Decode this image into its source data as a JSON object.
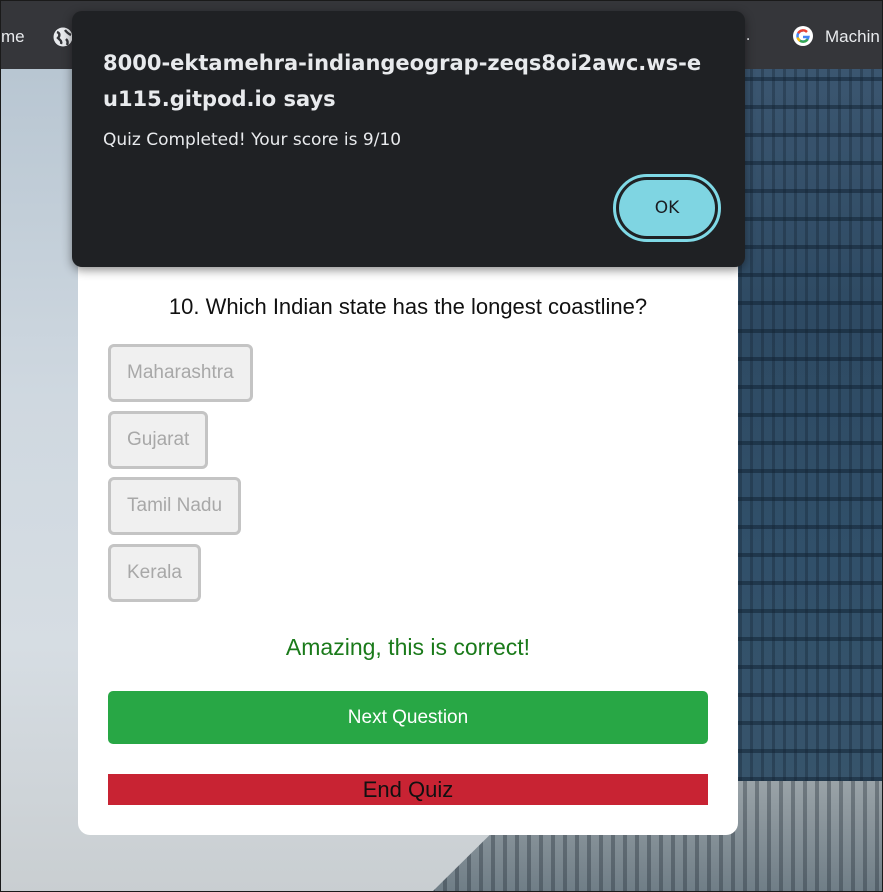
{
  "bookmarks": {
    "left_label": "me",
    "overflow_label": "..",
    "right_label": "Machin"
  },
  "dialog": {
    "title": "8000-ektamehra-indiangeograp-zeqs8oi2awc.ws-eu115.gitpod.io says",
    "message": "Quiz Completed! Your score is 9/10",
    "ok_label": "OK",
    "accent_color": "#7fd5e2"
  },
  "quiz": {
    "question": "10. Which Indian state has the longest coastline?",
    "options": [
      {
        "label": "Maharashtra"
      },
      {
        "label": "Gujarat"
      },
      {
        "label": "Tamil Nadu"
      },
      {
        "label": "Kerala"
      }
    ],
    "feedback": "Amazing, this is correct!",
    "next_label": "Next Question",
    "end_label": "End Quiz",
    "colors": {
      "success": "#28a745",
      "danger": "#c82333",
      "feedback": "#1a7a1a"
    }
  }
}
